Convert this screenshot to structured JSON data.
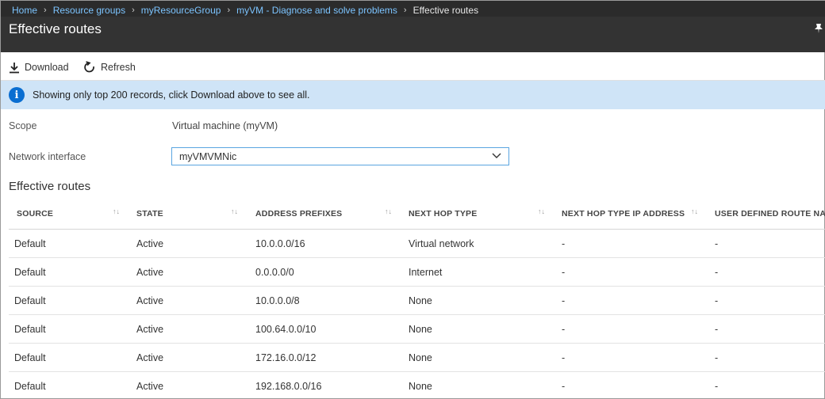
{
  "breadcrumb": [
    {
      "label": "Home"
    },
    {
      "label": "Resource groups"
    },
    {
      "label": "myResourceGroup"
    },
    {
      "label": "myVM - Diagnose and solve problems"
    },
    {
      "label": "Effective routes"
    }
  ],
  "header": {
    "title": "Effective routes",
    "pin_icon": "pin-icon"
  },
  "toolbar": {
    "download_label": "Download",
    "refresh_label": "Refresh",
    "download_icon": "download-icon",
    "refresh_icon": "refresh-icon"
  },
  "banner": {
    "text": "Showing only top 200 records, click Download above to see all.",
    "icon": "info-icon",
    "bg": "#cfe4f7"
  },
  "form": {
    "scope_label": "Scope",
    "scope_value": "Virtual machine (myVM)",
    "nic_label": "Network interface",
    "nic_value": "myVMVMNic"
  },
  "section_title": "Effective routes",
  "table": {
    "columns": [
      "SOURCE",
      "STATE",
      "ADDRESS PREFIXES",
      "NEXT HOP TYPE",
      "NEXT HOP TYPE IP ADDRESS",
      "USER DEFINED ROUTE NAME"
    ],
    "rows": [
      [
        "Default",
        "Active",
        "10.0.0.0/16",
        "Virtual network",
        "-",
        "-"
      ],
      [
        "Default",
        "Active",
        "0.0.0.0/0",
        "Internet",
        "-",
        "-"
      ],
      [
        "Default",
        "Active",
        "10.0.0.0/8",
        "None",
        "-",
        "-"
      ],
      [
        "Default",
        "Active",
        "100.64.0.0/10",
        "None",
        "-",
        "-"
      ],
      [
        "Default",
        "Active",
        "172.16.0.0/12",
        "None",
        "-",
        "-"
      ],
      [
        "Default",
        "Active",
        "192.168.0.0/16",
        "None",
        "-",
        "-"
      ]
    ]
  },
  "colors": {
    "topbar": "#2b2b2b",
    "link": "#7cc4ff",
    "accent": "#0078d4"
  }
}
